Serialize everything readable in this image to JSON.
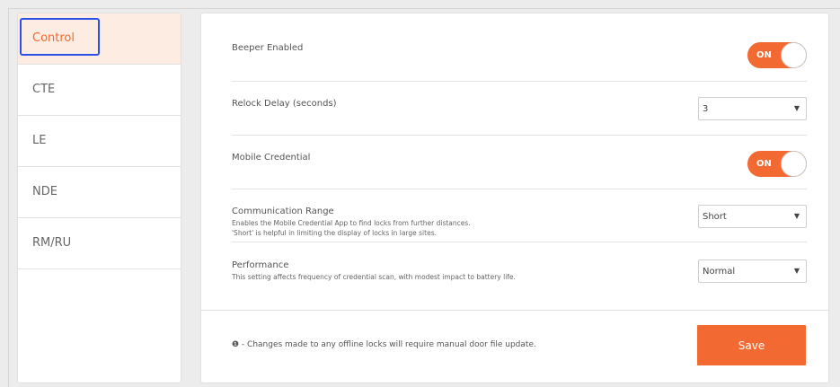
{
  "sidebar": {
    "items": [
      {
        "label": "Control"
      },
      {
        "label": "CTE"
      },
      {
        "label": "LE"
      },
      {
        "label": "NDE"
      },
      {
        "label": "RM/RU"
      }
    ]
  },
  "settings": {
    "beeper": {
      "label": "Beeper Enabled",
      "toggle": "ON"
    },
    "relock": {
      "label": "Relock Delay (seconds)",
      "value": "3"
    },
    "mobile": {
      "label": "Mobile Credential",
      "toggle": "ON"
    },
    "comm": {
      "label": "Communication Range",
      "desc1": "Enables the Mobile Credential App to find locks from further distances.",
      "desc2": "'Short' is helpful in limiting the display of locks in large sites.",
      "value": "Short"
    },
    "performance": {
      "label": "Performance",
      "desc": "This setting affects frequency of credential scan, with modest impact to battery life.",
      "value": "Normal"
    }
  },
  "footer": {
    "icon": "info-icon",
    "note": "❶ - Changes made to any offline locks will require manual door file update.",
    "save_label": "Save"
  },
  "colors": {
    "accent": "#f26a32",
    "focus": "#2a50e8",
    "active_bg": "#fdece2"
  }
}
